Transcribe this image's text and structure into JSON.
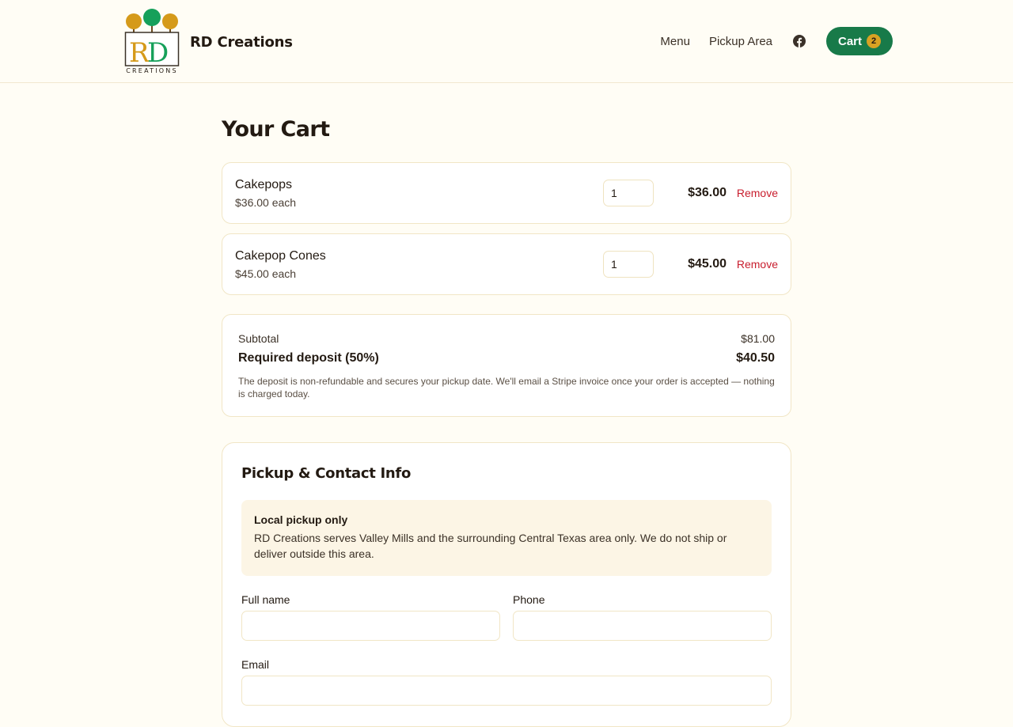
{
  "brand": {
    "name": "RD Creations",
    "logo_letters": "RD",
    "logo_sub": "CREATIONS"
  },
  "nav": {
    "menu": "Menu",
    "pickup_area": "Pickup Area",
    "facebook_icon": "facebook-icon",
    "cart_label": "Cart",
    "cart_count": "2"
  },
  "page": {
    "title": "Your Cart"
  },
  "cart": {
    "items": [
      {
        "name": "Cakepops",
        "each": "$36.00 each",
        "qty": "1",
        "total": "$36.00",
        "remove": "Remove"
      },
      {
        "name": "Cakepop Cones",
        "each": "$45.00 each",
        "qty": "1",
        "total": "$45.00",
        "remove": "Remove"
      }
    ]
  },
  "summary": {
    "subtotal_label": "Subtotal",
    "subtotal_value": "$81.00",
    "deposit_label": "Required deposit (50%)",
    "deposit_value": "$40.50",
    "note": "The deposit is non-refundable and secures your pickup date. We'll email a Stripe invoice once your order is accepted — nothing is charged today."
  },
  "form": {
    "title": "Pickup & Contact Info",
    "notice_title": "Local pickup only",
    "notice_text": "RD Creations serves Valley Mills and the surrounding Central Texas area only. We do not ship or deliver outside this area.",
    "full_name_label": "Full name",
    "full_name_value": "",
    "phone_label": "Phone",
    "phone_value": "",
    "email_label": "Email",
    "email_value": ""
  },
  "colors": {
    "accent_green": "#187a49",
    "badge_gold": "#d8a223",
    "remove_red": "#c81e2e",
    "background": "#fffdf5"
  }
}
